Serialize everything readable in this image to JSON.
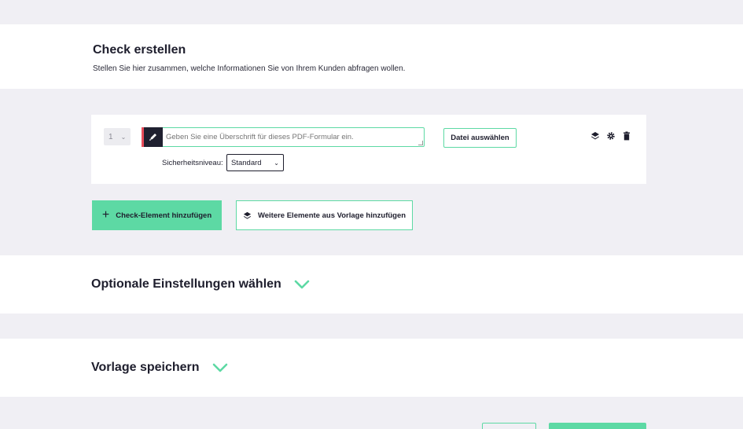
{
  "header": {
    "title": "Check erstellen",
    "subtitle": "Stellen Sie hier zusammen, welche Informationen Sie von Ihrem Kunden abfragen wollen."
  },
  "element": {
    "number": "1",
    "title_placeholder": "Geben Sie eine Überschrift für dieses PDF-Formular ein.",
    "file_button_label": "Datei auswählen",
    "security_label": "Sicherheitsniveau:",
    "security_value": "Standard",
    "icons": [
      "layers-icon",
      "gear-icon",
      "trash-icon"
    ]
  },
  "actions": {
    "add_element_label": "Check-Element hinzufügen",
    "add_from_template_label": "Weitere Elemente aus Vorlage hinzufügen"
  },
  "sections": {
    "optional_settings": "Optionale Einstellungen wählen",
    "save_template": "Vorlage speichern"
  },
  "colors": {
    "accent": "#5dd9a4",
    "dark": "#1e1e2d",
    "background": "#f0eff4",
    "marker": "#e84c5a"
  }
}
